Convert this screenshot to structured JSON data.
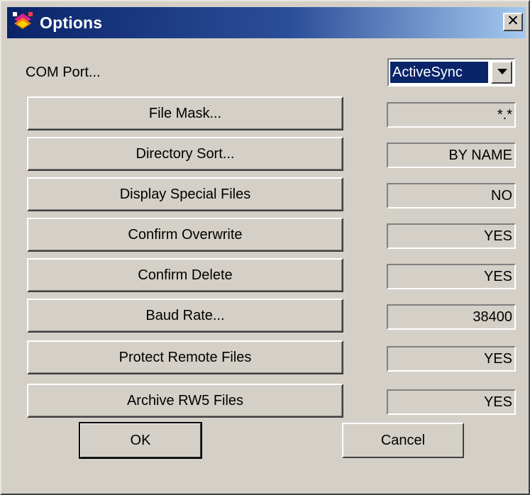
{
  "window": {
    "title": "Options",
    "close_label": "✕"
  },
  "com_port": {
    "label": "COM Port...",
    "selected": "ActiveSync"
  },
  "options": [
    {
      "button": "File Mask...",
      "value": "*.*"
    },
    {
      "button": "Directory Sort...",
      "value": "BY NAME"
    },
    {
      "button": "Display Special Files",
      "value": "NO"
    },
    {
      "button": "Confirm Overwrite",
      "value": "YES"
    },
    {
      "button": "Confirm Delete",
      "value": "YES"
    },
    {
      "button": "Baud Rate...",
      "value": "38400"
    },
    {
      "button": "Protect Remote Files",
      "value": "YES"
    },
    {
      "button": "Archive RW5 Files",
      "value": "YES"
    }
  ],
  "footer": {
    "ok_label": "OK",
    "cancel_label": "Cancel"
  },
  "icons": {
    "title_icon": "app-logo-icon",
    "close_icon": "close-icon",
    "dropdown_icon": "chevron-down-icon"
  },
  "colors": {
    "titlebar_start": "#0a246a",
    "titlebar_end": "#a6caf0",
    "dialog_face": "#d4d0c8",
    "selection": "#0a246a"
  }
}
